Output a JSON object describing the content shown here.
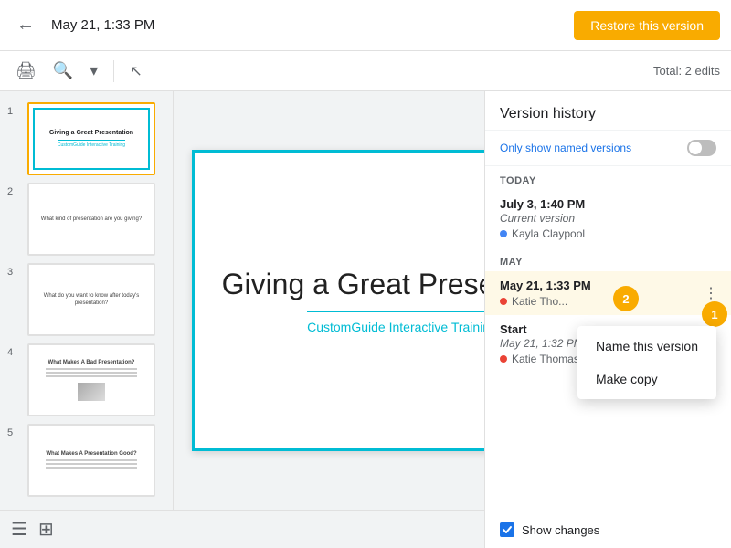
{
  "topBar": {
    "backArrow": "←",
    "dateTitle": "May 21, 1:33 PM",
    "restoreLabel": "Restore this version"
  },
  "secondBar": {
    "totalEdits": "Total: 2 edits",
    "icons": [
      "🖨",
      "🔍",
      "▾",
      "⬆"
    ]
  },
  "slides": [
    {
      "num": "1",
      "active": true,
      "type": "title"
    },
    {
      "num": "2",
      "active": false,
      "type": "question1",
      "text": "What kind of presentation are you giving?"
    },
    {
      "num": "3",
      "active": false,
      "type": "question2",
      "text": "What do you want to know after today's presentation?"
    },
    {
      "num": "4",
      "active": false,
      "type": "question3",
      "text": "What Makes A Bad Presentation?"
    },
    {
      "num": "5",
      "active": false,
      "type": "question4",
      "text": "What Makes A Presentation Good?"
    }
  ],
  "mainSlide": {
    "title": "Giving a Great Presentation",
    "subtitle": "CustomGuide Interactive Training"
  },
  "versionHistory": {
    "title": "Version history",
    "toggleLabel": "Only show",
    "toggleNamed": "named versions",
    "today": {
      "label": "TODAY",
      "versions": [
        {
          "time": "July 3, 1:40 PM",
          "sub": "Current version",
          "user": "Kayla Claypool",
          "dotColor": "#4285f4"
        }
      ]
    },
    "may": {
      "label": "MAY",
      "versions": [
        {
          "time": "May 21, 1:33 PM",
          "sub": "",
          "user": "Katie Thomas",
          "dotColor": "#ea4335",
          "active": true,
          "showMenu": true
        },
        {
          "time": "Start",
          "sub": "May 21, 1:32 PM",
          "user": "Katie Thomas",
          "dotColor": "#ea4335",
          "active": false,
          "showMenu": false
        }
      ]
    },
    "contextMenu": {
      "items": [
        "Name this version",
        "Make copy"
      ]
    },
    "showChanges": "Show changes"
  },
  "callouts": {
    "badge1": "1",
    "badge2": "2"
  }
}
